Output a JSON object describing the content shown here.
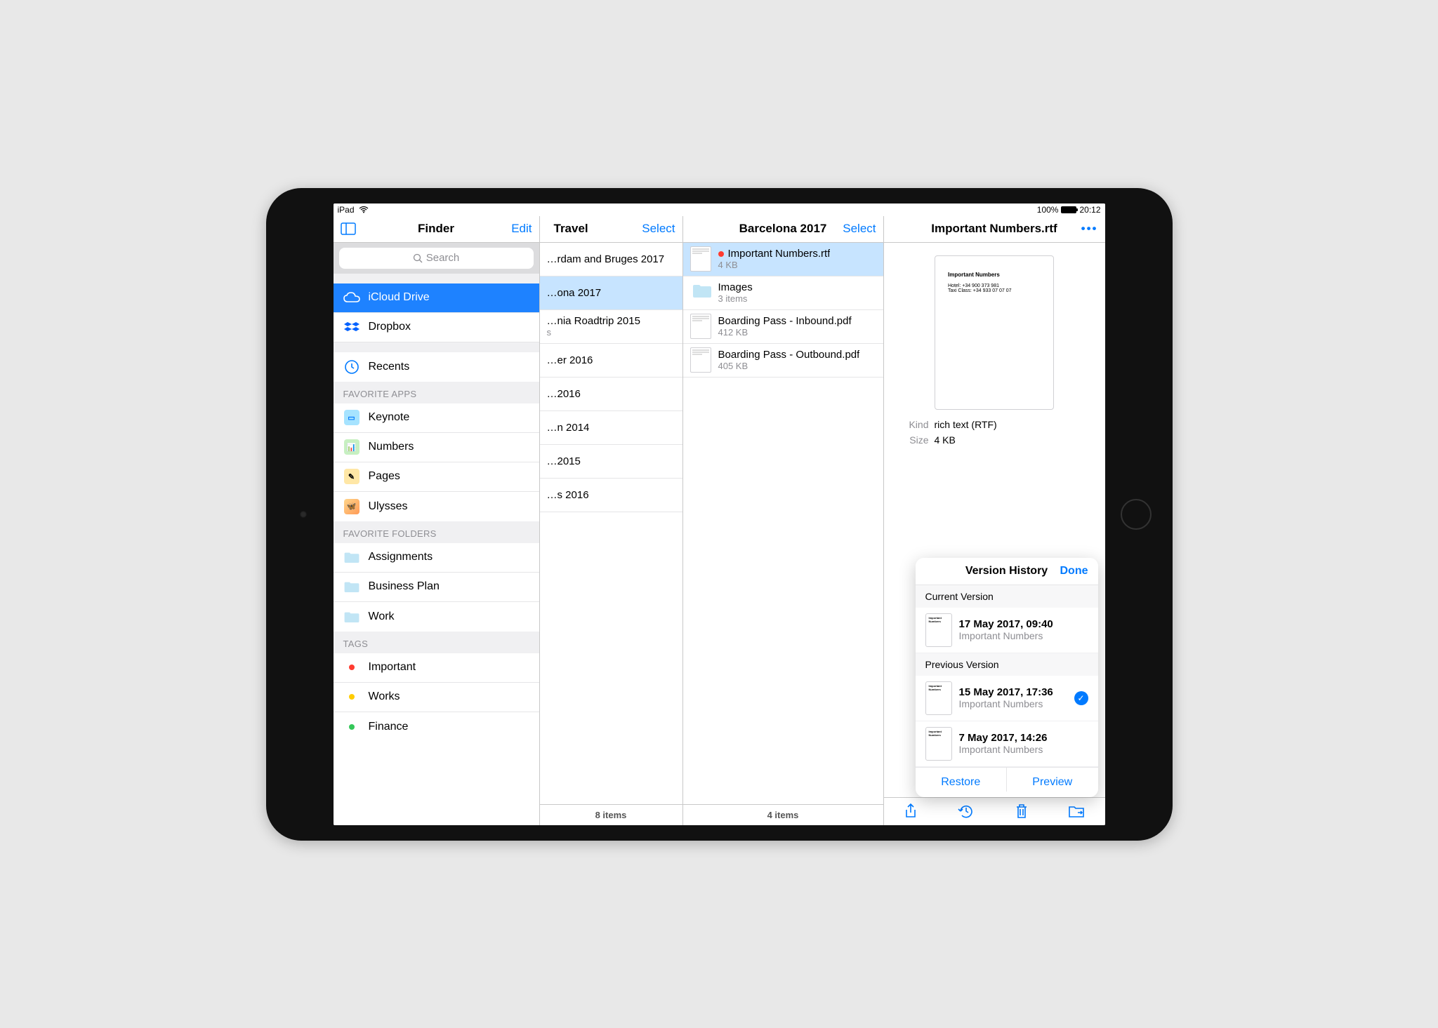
{
  "status": {
    "device": "iPad",
    "battery": "100%",
    "time": "20:12"
  },
  "sidebar": {
    "header_title": "Finder",
    "edit_label": "Edit",
    "search_placeholder": "Search",
    "sources": [
      {
        "label": "iCloud Drive",
        "selected": true
      },
      {
        "label": "Dropbox",
        "selected": false
      }
    ],
    "recents_label": "Recents",
    "sec_apps": "FAVORITE APPS",
    "apps": [
      {
        "label": "Keynote"
      },
      {
        "label": "Numbers"
      },
      {
        "label": "Pages"
      },
      {
        "label": "Ulysses"
      }
    ],
    "sec_folders": "FAVORITE FOLDERS",
    "folders": [
      {
        "label": "Assignments"
      },
      {
        "label": "Business Plan"
      },
      {
        "label": "Work"
      }
    ],
    "sec_tags": "TAGS",
    "tags": [
      {
        "label": "Important",
        "color": "#ff3b30"
      },
      {
        "label": "Works",
        "color": "#ffcc00"
      },
      {
        "label": "Finance",
        "color": "#34c759"
      }
    ]
  },
  "col_travel": {
    "title": "Travel",
    "select_label": "Select",
    "footer": "8 items",
    "items": [
      {
        "name": "…rdam and Bruges 2017"
      },
      {
        "name": "…ona 2017",
        "selected": true
      },
      {
        "name": "…nia Roadtrip 2015",
        "sub": "s"
      },
      {
        "name": "…er 2016"
      },
      {
        "name": "…2016"
      },
      {
        "name": "…n 2014"
      },
      {
        "name": "…2015"
      },
      {
        "name": "…s 2016"
      }
    ]
  },
  "col_barcelona": {
    "title": "Barcelona 2017",
    "select_label": "Select",
    "footer": "4 items",
    "items": [
      {
        "name": "Important Numbers.rtf",
        "sub": "4 KB",
        "tag": "#ff3b30",
        "selected": true,
        "kind": "doc"
      },
      {
        "name": "Images",
        "sub": "3 items",
        "kind": "folder"
      },
      {
        "name": "Boarding Pass - Inbound.pdf",
        "sub": "412 KB",
        "kind": "doc"
      },
      {
        "name": "Boarding Pass - Outbound.pdf",
        "sub": "405 KB",
        "kind": "doc"
      }
    ]
  },
  "preview": {
    "title": "Important Numbers.rtf",
    "doc_title": "Important Numbers",
    "doc_line1": "Hotel: +34 900 373 981",
    "doc_line2": "Taxi Class: +34 933 07 07 07",
    "meta_kind_k": "Kind",
    "meta_kind_v": "rich text (RTF)",
    "meta_size_k": "Size",
    "meta_size_v": "4 KB"
  },
  "popover": {
    "title": "Version History",
    "done": "Done",
    "sec_current": "Current Version",
    "sec_previous": "Previous Version",
    "current": {
      "ts": "17 May 2017, 09:40",
      "name": "Important Numbers"
    },
    "previous": [
      {
        "ts": "15 May 2017, 17:36",
        "name": "Important Numbers",
        "checked": true
      },
      {
        "ts": "7 May 2017, 14:26",
        "name": "Important Numbers",
        "checked": false
      }
    ],
    "restore": "Restore",
    "preview": "Preview"
  }
}
